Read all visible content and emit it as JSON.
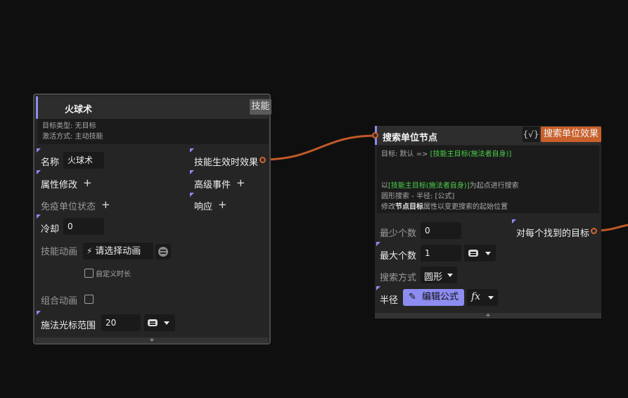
{
  "wires_color": "#c05a28",
  "accent": "#8d8cf0",
  "node1": {
    "title": "火球术",
    "tag": "技能",
    "desc": [
      "目标类型: 无目标",
      "激活方式: 主动技能"
    ],
    "name_label": "名称",
    "name_value": "火球术",
    "attr_modify_label": "属性修改",
    "immune_label": "免疫单位状态",
    "cooldown_label": "冷却",
    "cooldown_value": "0",
    "anim_label": "技能动画",
    "anim_select": "请选择动画",
    "custom_duration_label": "自定义时长",
    "combo_anim_label": "组合动画",
    "cursor_range_label": "施法光标范围",
    "cursor_range_value": "20",
    "out_effect_label": "技能生效时效果",
    "advanced_event_label": "高级事件",
    "response_label": "响应",
    "footer_plus": "+"
  },
  "node2": {
    "title": "搜索单位节点",
    "badge": "{√}",
    "tag": "搜索单位效果",
    "desc": {
      "target_prefix": "目标: 默认 => ",
      "target_value": "[技能主目标(施法者自身)]",
      "line2_prefix": "以",
      "line2_green": "[技能主目标(施法者自身)]",
      "line2_suffix": "为起点进行搜索",
      "line3": "圆形搜索 - 半径: [公式]",
      "line4_prefix": "修改",
      "line4_bold": "节点目标",
      "line4_suffix": "属性以变更搜索的起始位置"
    },
    "min_label": "最少个数",
    "min_value": "0",
    "max_label": "最大个数",
    "max_value": "1",
    "mode_label": "搜索方式",
    "mode_value": "圆形",
    "radius_label": "半径",
    "edit_formula": "编辑公式",
    "fx": "fx",
    "out_label": "对每个找到的目标",
    "footer_plus": "+"
  }
}
